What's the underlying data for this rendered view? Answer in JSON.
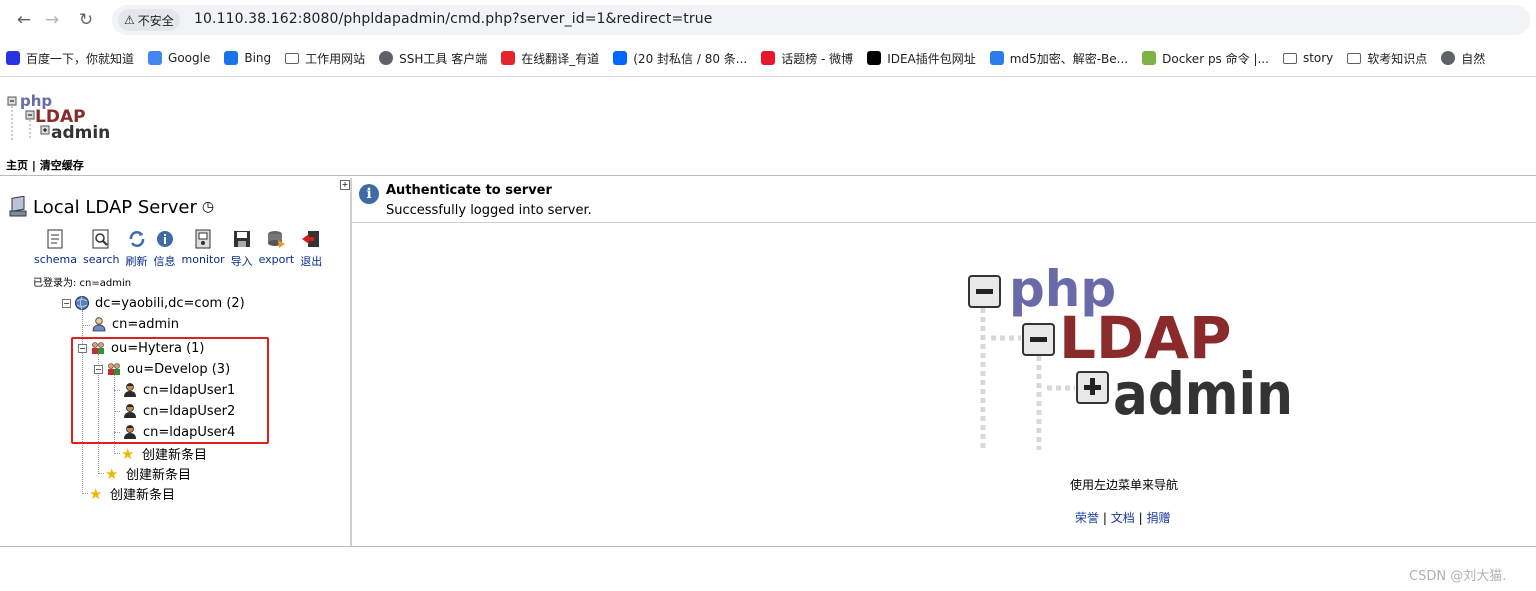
{
  "browser": {
    "security_label": "不安全",
    "url": "10.110.38.162:8080/phpldapadmin/cmd.php?server_id=1&redirect=true",
    "bookmarks": [
      {
        "label": "百度一下，你就知道",
        "icon": "baidu-icon",
        "color": "#2932e1"
      },
      {
        "label": "Google",
        "icon": "google-icon",
        "color": "#4285f4"
      },
      {
        "label": "Bing",
        "icon": "bing-icon",
        "color": "#1a73e8"
      },
      {
        "label": "工作用网站",
        "icon": "folder-icon",
        "color": ""
      },
      {
        "label": "SSH工具 客户端",
        "icon": "globe-icon",
        "color": "#5f6368"
      },
      {
        "label": "在线翻译_有道",
        "icon": "youdao-icon",
        "color": "#e4252b"
      },
      {
        "label": "(20 封私信 / 80 条...",
        "icon": "zhihu-icon",
        "color": "#0066ff"
      },
      {
        "label": "话题榜 - 微博",
        "icon": "weibo-icon",
        "color": "#e6162d"
      },
      {
        "label": "IDEA插件包网址",
        "icon": "terminal-icon",
        "color": "#000000"
      },
      {
        "label": "md5加密、解密-Be...",
        "icon": "b-icon",
        "color": "#2b7de9"
      },
      {
        "label": "Docker ps 命令 |...",
        "icon": "docker-icon",
        "color": "#7cb342"
      },
      {
        "label": "story",
        "icon": "folder-icon",
        "color": ""
      },
      {
        "label": "软考知识点",
        "icon": "folder-icon",
        "color": ""
      },
      {
        "label": "自然",
        "icon": "globe-icon",
        "color": "#5f6368"
      }
    ]
  },
  "menu": {
    "home": "主页",
    "sep": "|",
    "clear_cache": "清空缓存"
  },
  "server": {
    "name": "Local LDAP Server",
    "logged_in": "已登录为: cn=admin"
  },
  "tools": [
    "schema",
    "search",
    "刷新",
    "信息",
    "monitor",
    "导入",
    "export",
    "退出"
  ],
  "tree": {
    "root": "dc=yaobili,dc=com (2)",
    "admin": "cn=admin",
    "ou_hytera": "ou=Hytera (1)",
    "ou_develop": "ou=Develop (3)",
    "users": [
      "cn=ldapUser1",
      "cn=ldapUser2",
      "cn=ldapUser4"
    ],
    "create_new": "创建新条目"
  },
  "message": {
    "title": "Authenticate to server",
    "body": "Successfully logged into server."
  },
  "main": {
    "nav_hint": "使用左边菜单来导航",
    "links": [
      "荣誉",
      "文档",
      "捐赠"
    ],
    "link_sep": "|"
  },
  "watermark": "CSDN @刘大猫.",
  "colors": {
    "highlight": "#e02020",
    "link": "#1a3a9a",
    "logo_php": "#6a6aa8",
    "logo_ldap": "#8b2a2a",
    "logo_admin": "#333333"
  }
}
